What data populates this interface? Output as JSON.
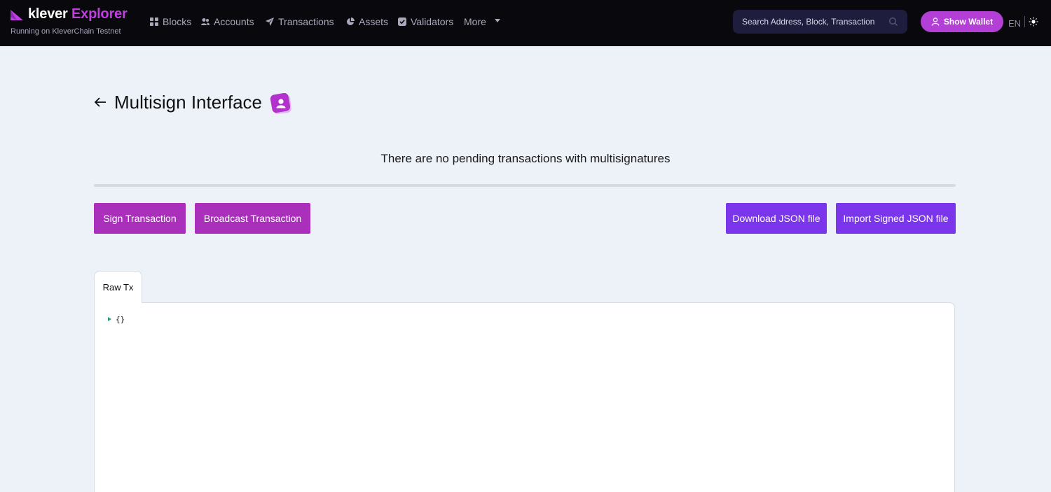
{
  "brand": {
    "name_part1": "klever",
    "name_part2": "Explorer",
    "subtitle": "Running on KleverChain Testnet",
    "logo_icon": "klever-logo-icon"
  },
  "nav": {
    "items": [
      {
        "label": "Blocks",
        "icon": "grid-icon"
      },
      {
        "label": "Accounts",
        "icon": "users-icon"
      },
      {
        "label": "Transactions",
        "icon": "paper-plane-icon"
      },
      {
        "label": "Assets",
        "icon": "pie-chart-icon"
      },
      {
        "label": "Validators",
        "icon": "check-square-icon"
      },
      {
        "label": "More",
        "icon": "chevron-down-icon"
      }
    ]
  },
  "search": {
    "placeholder": "Search Address, Block, Transaction",
    "value": ""
  },
  "wallet_button": {
    "label": "Show Wallet"
  },
  "language": "EN",
  "page": {
    "title": "Multisign Interface",
    "empty_message": "There are no pending transactions with multisignatures"
  },
  "actions": {
    "sign": "Sign Transaction",
    "broadcast": "Broadcast Transaction",
    "download": "Download JSON file",
    "import": "Import Signed JSON file"
  },
  "tabs": [
    {
      "label": "Raw Tx"
    }
  ],
  "raw_tx": {
    "content": "{}"
  },
  "colors": {
    "navbar_bg": "#08080d",
    "brand_accent": "#c13fe0",
    "primary_magenta": "#aa2fbb",
    "primary_violet": "#7b35ea",
    "page_bg": "#edf1f8"
  }
}
